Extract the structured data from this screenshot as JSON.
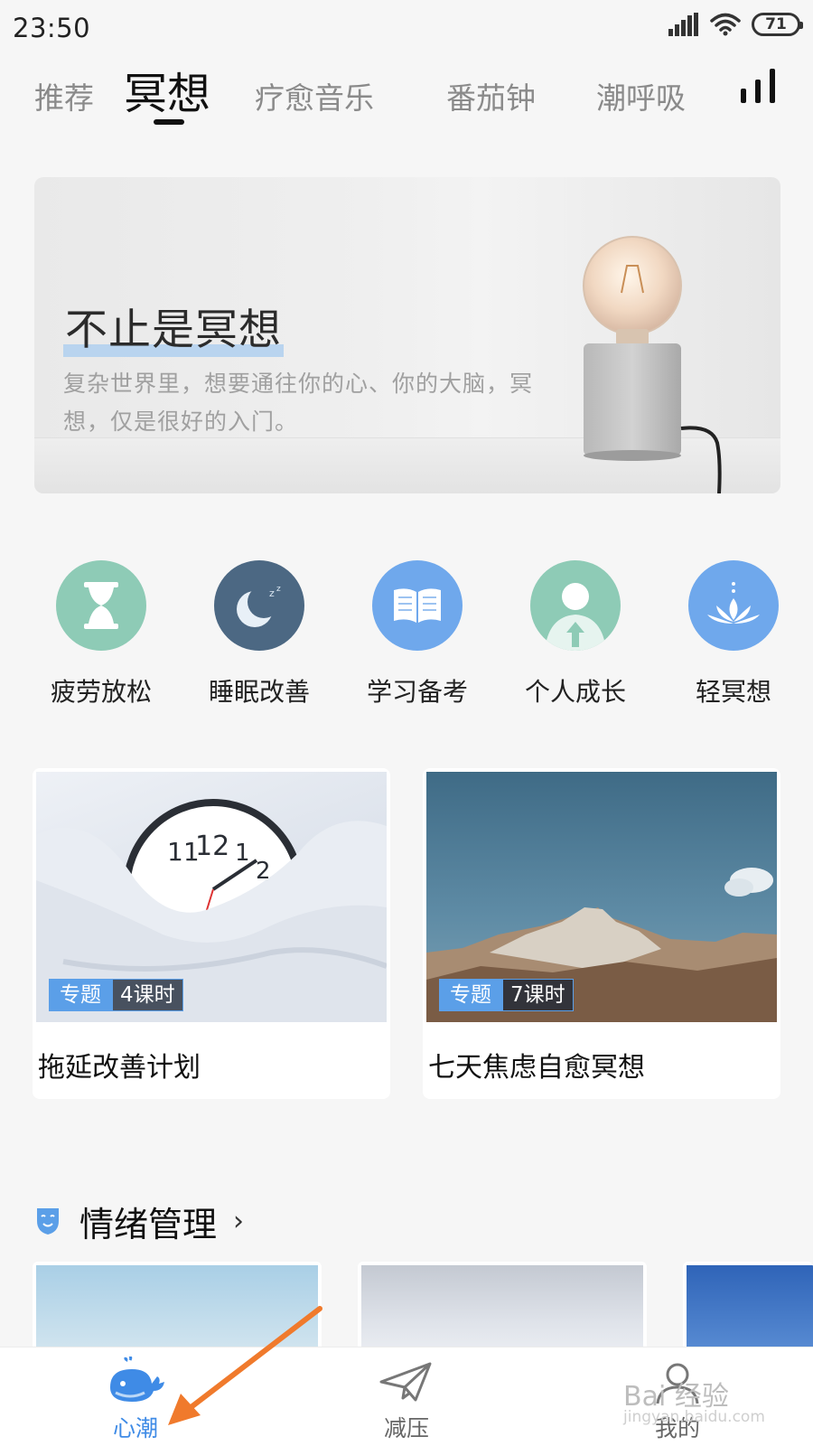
{
  "status_bar": {
    "time": "23:50",
    "battery": "71"
  },
  "tabs": [
    {
      "label": "推荐",
      "active": false
    },
    {
      "label": "冥想",
      "active": true
    },
    {
      "label": "疗愈音乐",
      "active": false
    },
    {
      "label": "番茄钟",
      "active": false
    },
    {
      "label": "潮呼吸",
      "active": false
    }
  ],
  "banner": {
    "title": "不止是冥想",
    "description": "复杂世界里，想要通往你的心、你的大脑，冥想，仅是很好的入门。"
  },
  "categories": [
    {
      "label": "疲劳放松",
      "icon": "hourglass-icon",
      "color": "#8ecbb6"
    },
    {
      "label": "睡眠改善",
      "icon": "moon-sleep-icon",
      "color": "#4c6883"
    },
    {
      "label": "学习备考",
      "icon": "book-icon",
      "color": "#6fa8ec"
    },
    {
      "label": "个人成长",
      "icon": "person-growth-icon",
      "color": "#8ecbb6"
    },
    {
      "label": "轻冥想",
      "icon": "lotus-icon",
      "color": "#6fa8ec"
    }
  ],
  "courses": [
    {
      "title": "拖延改善计划",
      "tag": "专题",
      "lessons": "4课时",
      "image": "clock-in-cloth"
    },
    {
      "title": "七天焦虑自愈冥想",
      "tag": "专题",
      "lessons": "7课时",
      "image": "mountain-sky"
    }
  ],
  "section": {
    "title": "情绪管理",
    "arrow": "›"
  },
  "bottom_nav": [
    {
      "label": "心潮",
      "icon": "whale-icon",
      "active": true
    },
    {
      "label": "减压",
      "icon": "paper-plane-icon",
      "active": false
    },
    {
      "label": "我的",
      "icon": "profile-icon",
      "active": false
    }
  ],
  "watermark": {
    "text": "Bai 经验",
    "sub": "jingyan.baidu.com"
  },
  "colors": {
    "accent": "#3f8be6",
    "annotation_arrow": "#f07a2c"
  }
}
